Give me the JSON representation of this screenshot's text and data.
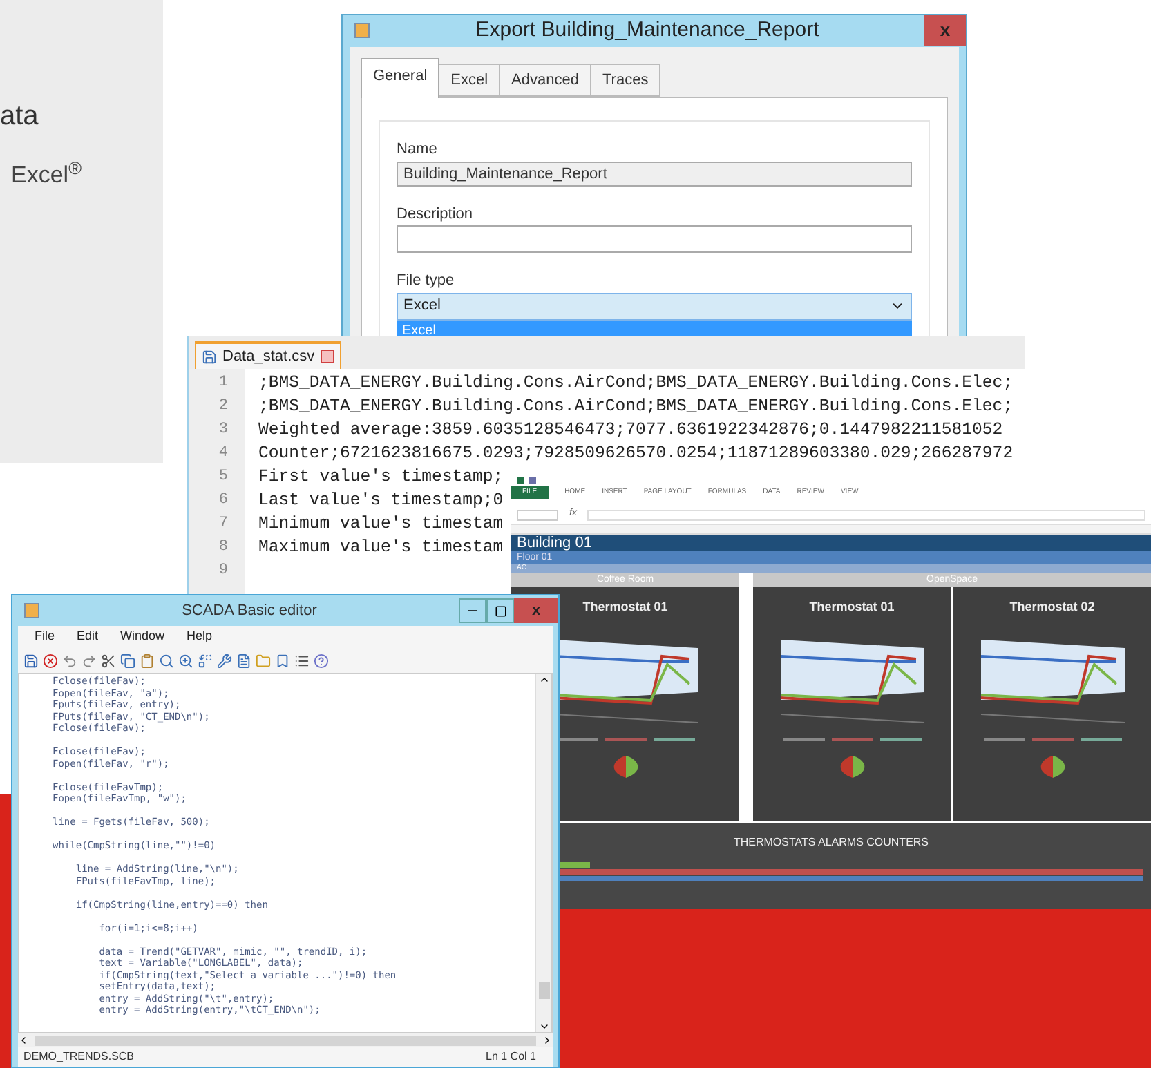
{
  "background_text": [
    {
      "text": "ata"
    },
    {
      "text": "Excel$^{®}$"
    }
  ],
  "export_dialog": {
    "title": "Export Building_Maintenance_Report",
    "close": "x",
    "tabs": [
      {
        "label": "General",
        "selected": true
      },
      {
        "label": "Excel",
        "selected": false
      },
      {
        "label": "Advanced",
        "selected": false
      },
      {
        "label": "Traces",
        "selected": false
      }
    ],
    "fields": [
      {
        "label": "Name",
        "value": "Building_Maintenance_Report",
        "kind": "readonly"
      },
      {
        "label": "Description",
        "kind": "text"
      },
      {
        "label": "File type",
        "value": "Excel",
        "kind": "select"
      }
    ],
    "dropdown_items": [
      {
        "label": "Excel",
        "selected": true
      }
    ]
  },
  "csv_editor": {
    "tab": "Data_stat.csv",
    "lines": [
      {
        "number": "1",
        "text": ";BMS_DATA_ENERGY.Building.Cons.AirCond;BMS_DATA_ENERGY.Building.Cons.Elec;"
      },
      {
        "number": "2",
        "text": ";BMS_DATA_ENERGY.Building.Cons.AirCond;BMS_DATA_ENERGY.Building.Cons.Elec;"
      },
      {
        "number": "3",
        "text": "Weighted average:3859.6035128546473;7077.6361922342876;0.1447982211581052"
      },
      {
        "number": "4",
        "text": "Counter;6721623816675.0293;7928509626570.0254;11871289603380.029;266287972"
      },
      {
        "number": "5",
        "text": "First value's timestamp;"
      },
      {
        "number": "6",
        "text": "Last value's timestamp;0"
      },
      {
        "number": "7",
        "text": "Minimum value's timestam"
      },
      {
        "number": "8",
        "text": "Maximum value's timestam"
      },
      {
        "number": "9"
      }
    ]
  },
  "excel": {
    "ribbon_tabs": [
      {
        "label": "FILE",
        "selected": true
      },
      {
        "label": "HOME",
        "selected": false
      },
      {
        "label": "INSERT",
        "selected": false
      },
      {
        "label": "PAGE LAYOUT",
        "selected": false
      },
      {
        "label": "FORMULAS",
        "selected": false
      },
      {
        "label": "DATA",
        "selected": false
      },
      {
        "label": "REVIEW",
        "selected": false
      },
      {
        "label": "VIEW",
        "selected": false
      }
    ],
    "formula_symbol": "fx",
    "header_rows": [
      {
        "text": "Building 01",
        "kind": "title"
      },
      {
        "text": "Floor 01",
        "kind": "subtitle"
      },
      {
        "text": "AC",
        "kind": "group"
      }
    ],
    "rooms": [
      {
        "name": "Coffee Room",
        "thermostats": [
          "Thermostat 01"
        ]
      },
      {
        "name": "OpenSpace",
        "thermostats": [
          "Thermostat 01",
          "Thermostat 02"
        ]
      }
    ],
    "alarms_title": "THERMOSTATS ALARMS COUNTERS"
  },
  "scada_editor": {
    "title": "SCADA Basic editor",
    "close": "x",
    "menu": [
      "File",
      "Edit",
      "Window",
      "Help"
    ],
    "code_blocks": [
      [
        "Fclose(fileFav);",
        "Fopen(fileFav, \"a\");",
        "Fputs(fileFav, entry);",
        "FPuts(fileFav, \"CT_END\\n\");",
        "Fclose(fileFav);"
      ],
      [
        "Fclose(fileFav);",
        "Fopen(fileFav, \"r\");"
      ],
      [
        "Fclose(fileFavTmp);",
        "Fopen(fileFavTmp, \"w\");"
      ],
      [
        "line = Fgets(fileFav, 500);"
      ],
      [
        "while(CmpString(line,\"\")!=0)"
      ],
      [
        "    line = AddString(line,\"\\n\");",
        "    FPuts(fileFavTmp, line);"
      ],
      [
        "    if(CmpString(line,entry)==0) then"
      ],
      [
        "        for(i=1;i<=8;i++)"
      ],
      [
        "        data = Trend(\"GETVAR\", mimic, \"\", trendID, i);",
        "        text = Variable(\"LONGLABEL\", data);",
        "        if(CmpString(text,\"Select a variable ...\")!=0) then",
        "        setEntry(data,text);",
        "        entry = AddString(\"\\t\",entry);",
        "        entry = AddString(entry,\"\\tCT_END\\n\");"
      ]
    ],
    "status_left": "DEMO_TRENDS.SCB",
    "status_right": "Ln 1 Col 1"
  }
}
